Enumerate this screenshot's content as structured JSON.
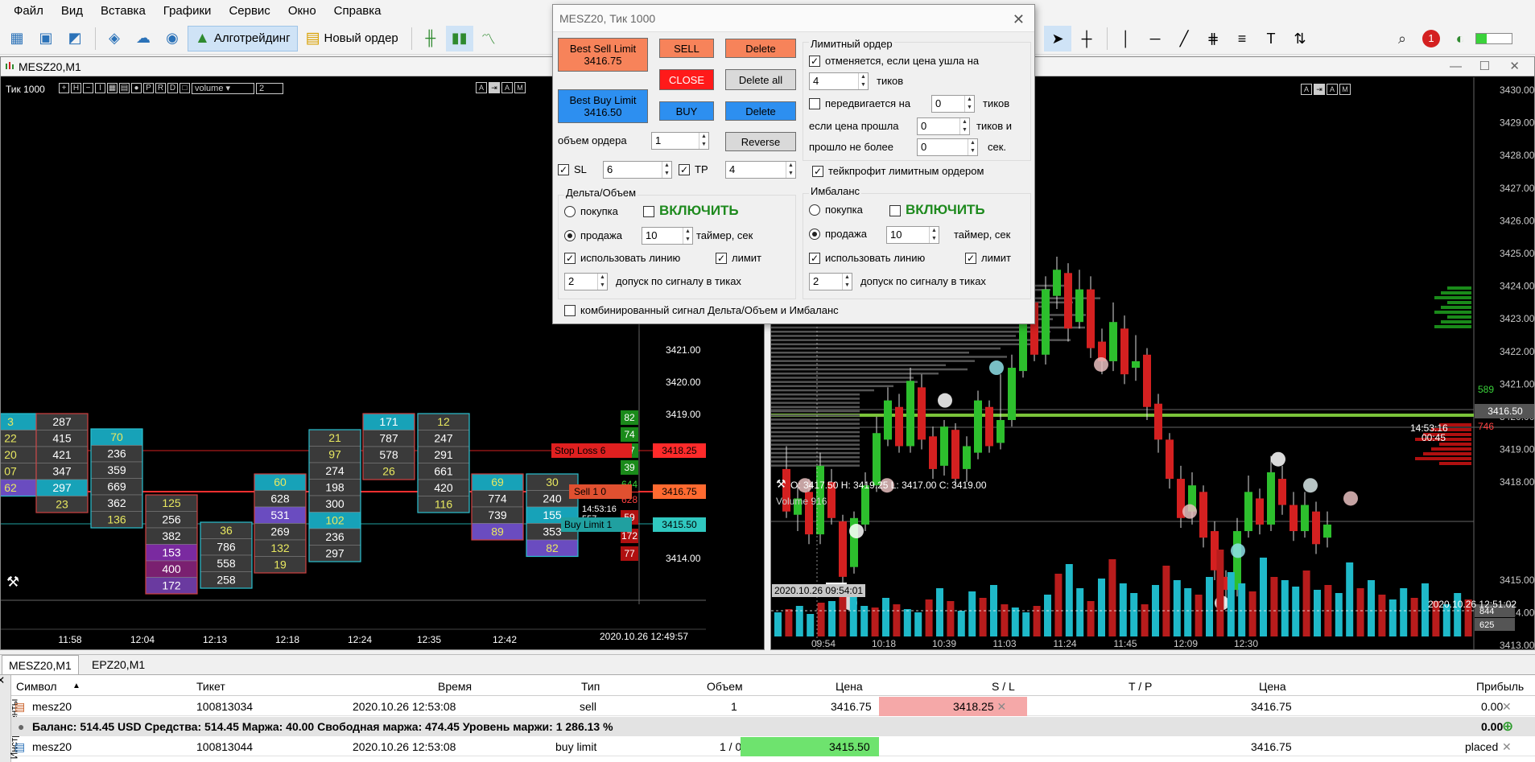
{
  "menu": [
    "Файл",
    "Вид",
    "Вставка",
    "Графики",
    "Сервис",
    "Окно",
    "Справка"
  ],
  "toolbar": {
    "algo_label": "Алготрейдинг",
    "new_order_label": "Новый ордер"
  },
  "windows": {
    "left": {
      "title": "MESZ20,M1",
      "tick_label": "Тик  1000",
      "volume_select": "volume",
      "volume_spin": "2"
    },
    "right": {
      "ohlc": "O: 3417.50   H: 3419.25   L: 3417.00   C: 3419.00",
      "volume_label": "Volume 916",
      "volume_marker": "916"
    }
  },
  "left_chart": {
    "price_labels": [
      "3421.00",
      "3420.00",
      "3419.00",
      "3415.00",
      "3414.00"
    ],
    "time_labels": [
      "11:58",
      "12:04",
      "12:13",
      "12:18",
      "12:24",
      "12:35",
      "12:42"
    ],
    "datetime": "2020.10.26 12:49:57",
    "stop_loss_label": "Stop Loss   6",
    "stop_loss_price": "3418.25",
    "sell_label": "Sell  1   0",
    "sell_price": "3416.75",
    "timer": "14:53:16",
    "timer_sub": "557",
    "buy_limit_label": "Buy Limit  1",
    "buy_limit_price": "3415.50",
    "ladder": [
      "82",
      "74",
      "37",
      "39",
      "644",
      "628",
      "59",
      "172",
      "77"
    ],
    "clusters": [
      {
        "cells": [
          "3",
          "22",
          "20",
          "07",
          "62"
        ]
      },
      {
        "cells": [
          "287",
          "415",
          "421",
          "347",
          "297",
          "23"
        ]
      },
      {
        "cells": [
          "70",
          "236",
          "359",
          "669",
          "362",
          "136"
        ]
      },
      {
        "cells": [
          "125",
          "256",
          "382",
          "153",
          "400",
          "172"
        ]
      },
      {
        "cells": [
          "36",
          "786",
          "558",
          "258"
        ]
      },
      {
        "cells": [
          "60",
          "628",
          "531",
          "269",
          "132",
          "19"
        ]
      },
      {
        "cells": [
          "21",
          "97",
          "274",
          "198",
          "300",
          "102",
          "236",
          "297"
        ]
      },
      {
        "cells": [
          "171",
          "787",
          "578",
          "26"
        ]
      },
      {
        "cells": [
          "12",
          "247",
          "291",
          "661",
          "420",
          "116"
        ]
      },
      {
        "cells": [
          "69",
          "774",
          "739",
          "89"
        ]
      },
      {
        "cells": [
          "30",
          "240",
          "155",
          "353",
          "82"
        ]
      }
    ]
  },
  "right_chart": {
    "price_labels": [
      "3430.00",
      "3429.00",
      "3428.00",
      "3427.00",
      "3426.00",
      "3425.00",
      "3424.00",
      "3423.00",
      "3422.00",
      "3421.00",
      "3420.00",
      "3419.00",
      "3418.00",
      "3416.50",
      "3415.00",
      "3414.00",
      "3413.00"
    ],
    "current_price": "3416.50",
    "timer": "14:53:16",
    "timer_sub": "00:45",
    "side_values": [
      "589",
      "746"
    ],
    "vol_labels": [
      "844",
      "625"
    ],
    "time_labels": [
      "09:54",
      "10:18",
      "10:39",
      "11:03",
      "11:24",
      "11:45",
      "12:09",
      "12:30"
    ],
    "datetime_left": "2020.10.26 09:54:01",
    "datetime_right": "2020.10.26 12:51:02"
  },
  "dialog": {
    "title": "MESZ20, Тик  1000",
    "best_sell_label": "Best Sell Limit",
    "best_sell_price": "3416.75",
    "best_buy_label": "Best Buy Limit",
    "best_buy_price": "3416.50",
    "sell": "SELL",
    "close": "CLOSE",
    "buy": "BUY",
    "delete": "Delete",
    "delete_all": "Delete all",
    "reverse": "Reverse",
    "volume_label": "объем ордера",
    "volume_value": "1",
    "sl_label": "SL",
    "sl_value": "6",
    "tp_label": "TP",
    "tp_value": "4",
    "limit_order": {
      "title": "Лимитный ордер",
      "cancel_label": "отменяется, если цена ушла на",
      "cancel_value": "4",
      "ticks": "тиков",
      "moves_label": "передвигается на",
      "moves_value": "0",
      "if_price_label": "если цена прошла",
      "if_price_value": "0",
      "ticks_and": "тиков и",
      "not_more_label": "прошло не более",
      "not_more_value": "0",
      "sec": "сек.",
      "takeprofit_label": "тейкпрофит лимитным ордером"
    },
    "delta": {
      "title": "Дельта/Объем",
      "buy": "покупка",
      "sell": "продажа",
      "enable": "ВКЛЮЧИТЬ",
      "timer_value": "10",
      "timer_label": "таймер, сек",
      "use_line": "использовать линию",
      "limit": "лимит",
      "tolerance_value": "2",
      "tolerance_label": "допуск по сигналу в тиках"
    },
    "imbalance": {
      "title": "Имбаланс",
      "buy": "покупка",
      "sell": "продажа",
      "enable": "ВКЛЮЧИТЬ",
      "timer_value": "10",
      "timer_label": "таймер, сек",
      "use_line": "использовать линию",
      "limit": "лимит",
      "tolerance_value": "2",
      "tolerance_label": "допуск по сигналу в тиках"
    },
    "combined_label": "комбинированный сигнал Дельта/Объем и Имбаланс"
  },
  "tabs": [
    "MESZ20,M1",
    "EPZ20,M1"
  ],
  "terminal": {
    "side_label": "Инструменты",
    "headers": [
      "Символ",
      "Тикет",
      "Время",
      "Тип",
      "Объем",
      "Цена",
      "S / L",
      "T / P",
      "Цена",
      "Прибыль"
    ],
    "rows": [
      [
        "mesz20",
        "100813034",
        "2020.10.26 12:53:08",
        "sell",
        "1",
        "3416.75",
        "3418.25",
        "",
        "3416.75",
        "0.00"
      ],
      [
        "mesz20",
        "100813044",
        "2020.10.26 12:53:08",
        "buy limit",
        "1 / 0",
        "3415.50",
        "",
        "",
        "3416.75",
        "placed"
      ]
    ],
    "balance": "Баланс: 514.45 USD  Средства: 514.45  Маржа: 40.00  Свободная маржа: 474.45  Уровень маржи: 1 286.13 %",
    "balance_profit": "0.00"
  },
  "colors": {
    "bull": "#2dbf2d",
    "bear": "#d42020",
    "cluster_cyan": "#1fb9c9",
    "cluster_purple": "#7060c8",
    "cluster_red": "#a0202a"
  }
}
